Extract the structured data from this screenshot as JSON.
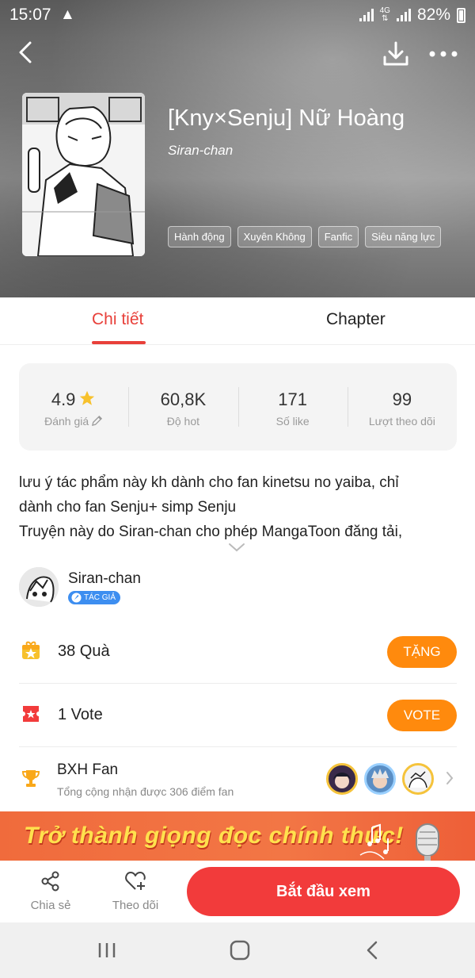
{
  "status_bar": {
    "time": "15:07",
    "network": "4G",
    "battery": "82%"
  },
  "header": {
    "title": "[Kny×Senju] Nữ Hoàng",
    "author": "Siran-chan",
    "tags": [
      "Hành động",
      "Xuyên Không",
      "Fanfic",
      "Siêu năng lực"
    ]
  },
  "tabs": {
    "detail": "Chi tiết",
    "chapter": "Chapter"
  },
  "stats": {
    "rating": {
      "value": "4.9",
      "label": "Đánh giá"
    },
    "hot": {
      "value": "60,8K",
      "label": "Độ hot"
    },
    "likes": {
      "value": "171",
      "label": "Số like"
    },
    "followers": {
      "value": "99",
      "label": "Lượt theo dõi"
    }
  },
  "description": {
    "line1": "lưu ý tác phẩm này kh dành cho fan kinetsu no yaiba, chỉ",
    "line2": "dành cho fan Senju+ simp Senju",
    "line3": "Truyện này do Siran-chan cho phép MangaToon đăng tải,"
  },
  "author_row": {
    "name": "Siran-chan",
    "badge": "TÁC GIẢ"
  },
  "gift": {
    "label": "38 Quà",
    "button": "TẶNG"
  },
  "vote": {
    "label": "1 Vote",
    "button": "VOTE"
  },
  "fan_ranking": {
    "title": "BXH Fan",
    "subtitle": "Tổng cộng nhận được 306 điểm fan"
  },
  "banner": {
    "text": "Trở thành giọng đọc chính thức!"
  },
  "bottom_bar": {
    "share": "Chia sẻ",
    "follow": "Theo dõi",
    "start": "Bắt đầu xem"
  },
  "colors": {
    "accent_red": "#e8403a",
    "button_orange": "#ff8a0d",
    "start_red": "#f23b3b",
    "badge_blue": "#3d8ef0"
  }
}
